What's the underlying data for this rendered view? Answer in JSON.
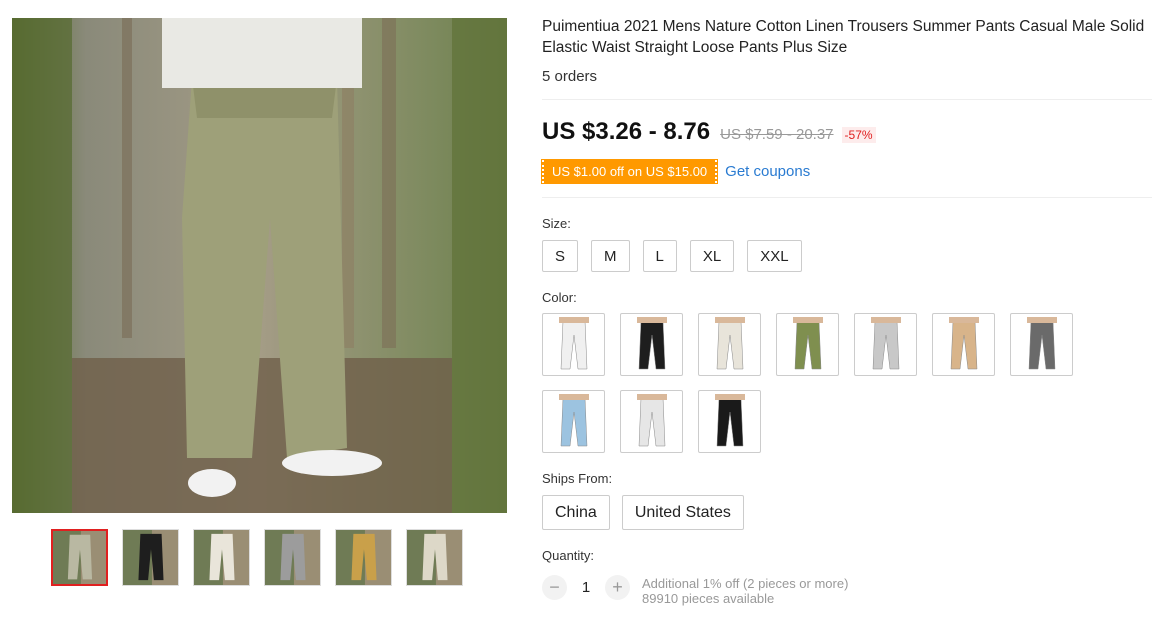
{
  "product": {
    "title": "Puimentiua 2021 Mens Nature Cotton Linen Trousers Summer Pants Casual Male Solid Elastic Waist Straight Loose Pants Plus Size",
    "orders": "5 orders"
  },
  "price": {
    "current": "US $3.26 - 8.76",
    "original": "US $7.59 - 20.37",
    "discount": "-57%"
  },
  "coupon": {
    "label": "US $1.00 off on US $15.00",
    "link": "Get coupons"
  },
  "size": {
    "label": "Size:",
    "options": [
      "S",
      "M",
      "L",
      "XL",
      "XXL"
    ]
  },
  "color": {
    "label": "Color:",
    "swatches": [
      "#f0f0f0",
      "#1e1e1e",
      "#e8e4da",
      "#7f8f4f",
      "#c8c8c8",
      "#d8b48a",
      "#6a6a6a",
      "#9cc3e0",
      "#e6e6e6",
      "#1a1a1a"
    ]
  },
  "ships": {
    "label": "Ships From:",
    "options": [
      "China",
      "United States"
    ]
  },
  "quantity": {
    "label": "Quantity:",
    "minus": "−",
    "plus": "+",
    "value": "1",
    "note": "Additional 1% off (2 pieces or more)",
    "available": "89910 pieces available"
  },
  "gallery": {
    "thumb_colors": [
      "#b9b8a2",
      "#1e1e1e",
      "#e9e5da",
      "#9c9c9c",
      "#c9a04a",
      "#ddd8c8"
    ]
  },
  "colors": {
    "price": "#111111",
    "discount": "#e02020",
    "coupon_bg": "#ff9900",
    "link": "#2a7bd1"
  }
}
